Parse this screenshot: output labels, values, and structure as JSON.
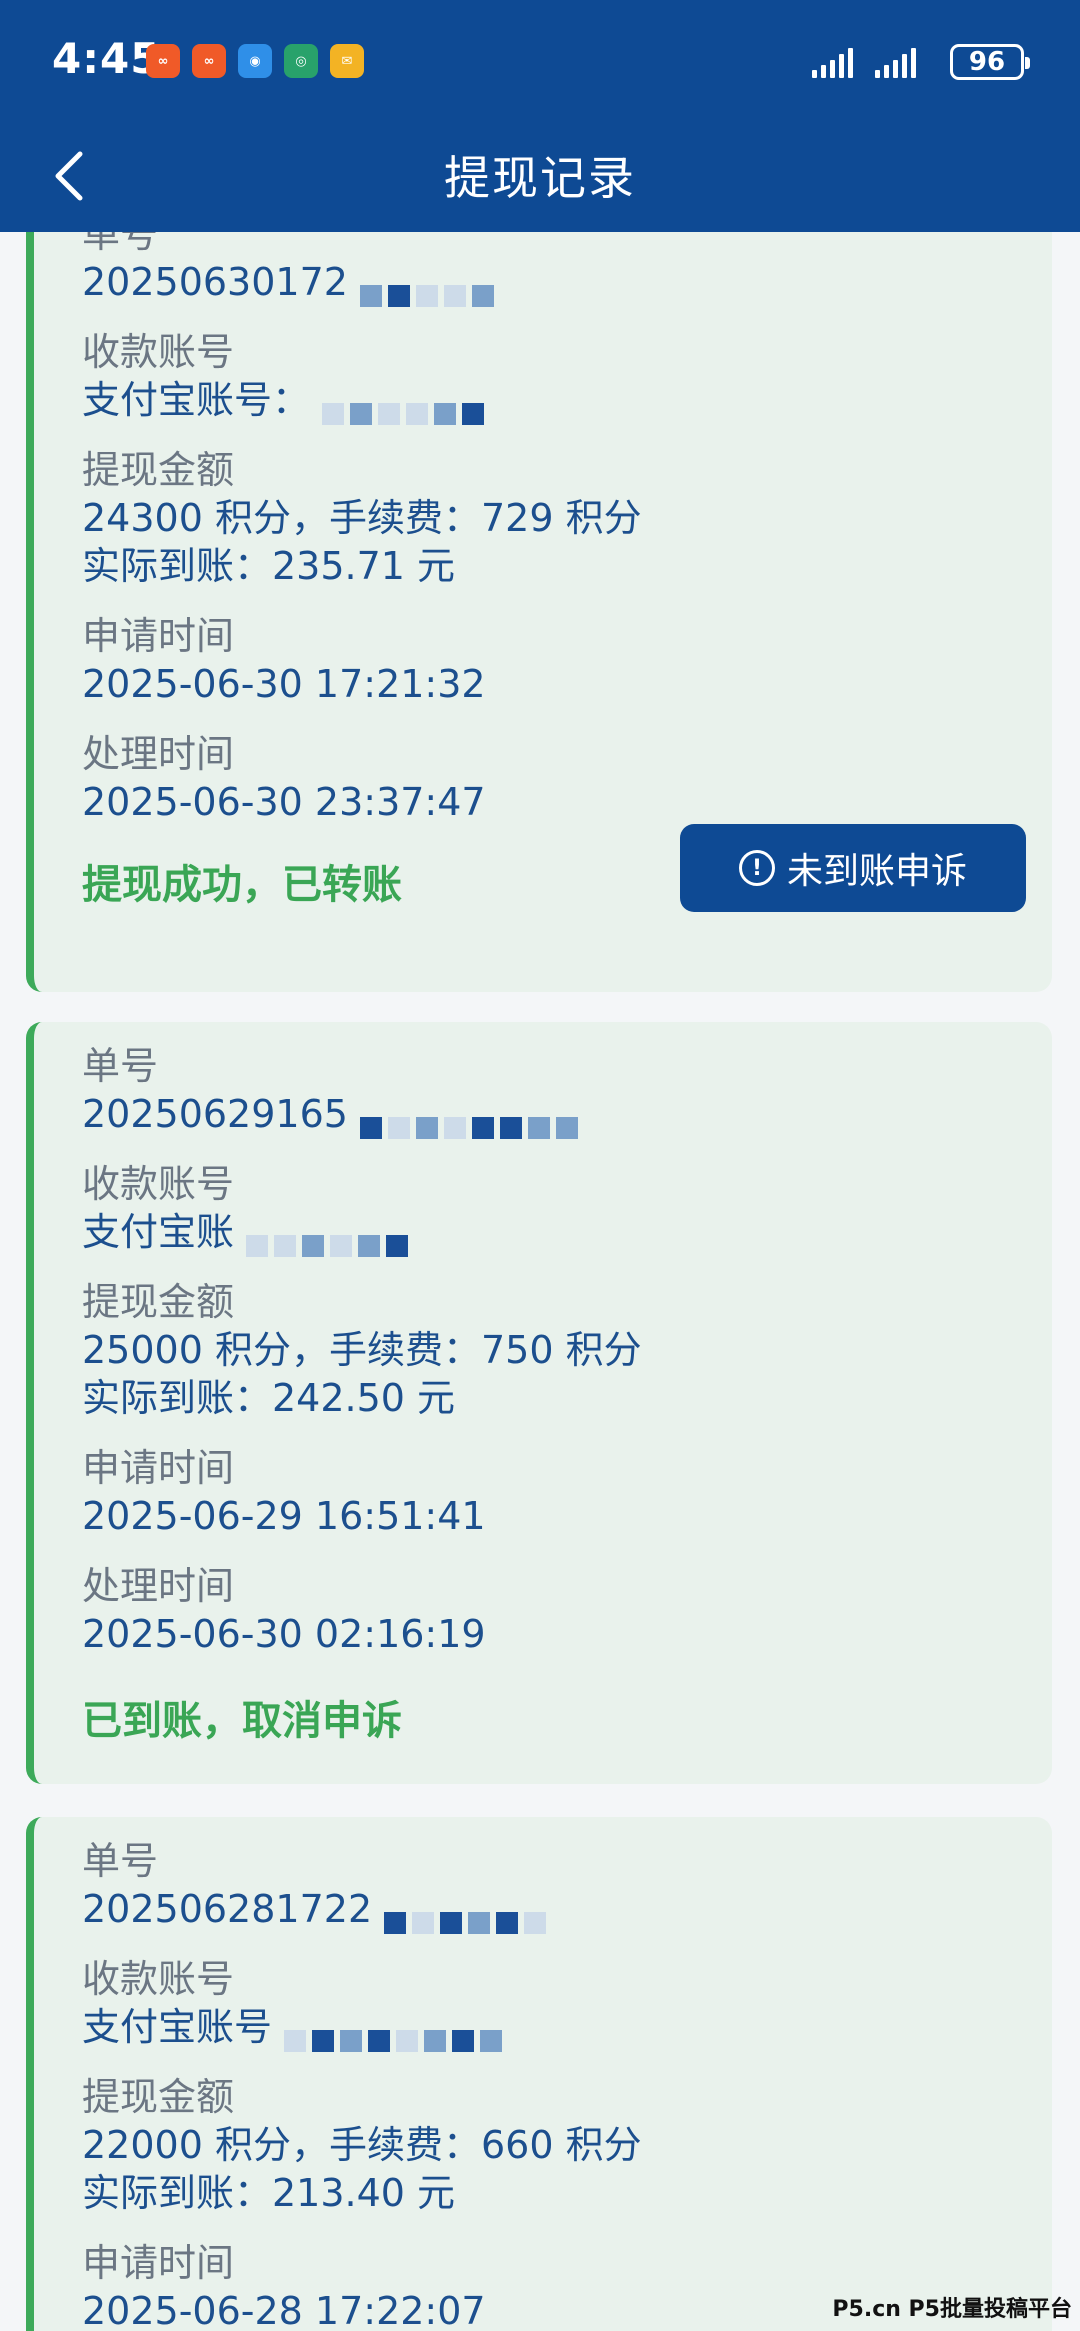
{
  "status_bar": {
    "time": "4:45",
    "battery": "96"
  },
  "header": {
    "title": "提现记录"
  },
  "records": [
    {
      "order_label": "单号",
      "order_value": "20250630172",
      "account_label": "收款账号",
      "account_value": "支付宝账号：",
      "amount_label": "提现金额",
      "amount_line1": "24300 积分，手续费：729 积分",
      "amount_line2": "实际到账：235.71 元",
      "apply_label": "申请时间",
      "apply_time": "2025-06-30 17:21:32",
      "process_label": "处理时间",
      "process_time": "2025-06-30 23:37:47",
      "status_text": "提现成功，已转账",
      "button_label": "未到账申诉"
    },
    {
      "order_label": "单号",
      "order_value": "20250629165",
      "account_label": "收款账号",
      "account_value": "支付宝账",
      "amount_label": "提现金额",
      "amount_line1": "25000 积分，手续费：750 积分",
      "amount_line2": "实际到账：242.50 元",
      "apply_label": "申请时间",
      "apply_time": "2025-06-29 16:51:41",
      "process_label": "处理时间",
      "process_time": "2025-06-30 02:16:19",
      "status_text": "已到账，取消申诉"
    },
    {
      "order_label": "单号",
      "order_value": "202506281722",
      "account_label": "收款账号",
      "account_value": "支付宝账号",
      "amount_label": "提现金额",
      "amount_line1": "22000 积分，手续费：660 积分",
      "amount_line2": "实际到账：213.40 元",
      "apply_label": "申请时间",
      "apply_time": "2025-06-28 17:22:07"
    }
  ],
  "watermark": "P5.cn P5批量投稿平台",
  "colors": {
    "header_bg": "#0e4a94",
    "card_bg": "#e9f2ec",
    "accent_green": "#3aa655",
    "value_blue": "#1c4f8e"
  },
  "icons": {
    "back": "chevron-left-icon",
    "info": "info-circle-icon"
  }
}
